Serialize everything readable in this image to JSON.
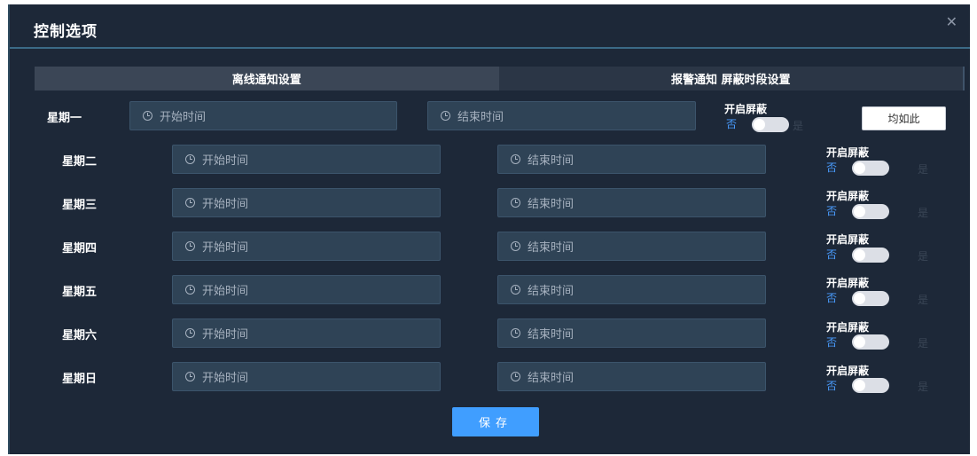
{
  "dialog": {
    "title": "控制选项",
    "close_icon": "close-icon"
  },
  "tabs": [
    {
      "label": "离线通知设置",
      "active": true
    },
    {
      "label": "报警通知 屏蔽时段设置",
      "active": false
    }
  ],
  "placeholders": {
    "start": "开始时间",
    "end": "结束时间"
  },
  "toggle": {
    "title": "开启屏蔽",
    "off": "否",
    "on": "是",
    "value": false
  },
  "days": [
    {
      "label": "星期一"
    },
    {
      "label": "星期二"
    },
    {
      "label": "星期三"
    },
    {
      "label": "星期四"
    },
    {
      "label": "星期五"
    },
    {
      "label": "星期六"
    },
    {
      "label": "星期日"
    }
  ],
  "actions": {
    "same_label": "均如此",
    "save_label": "保存"
  },
  "colors": {
    "background": "#1d2838",
    "field": "#2f4356",
    "accent": "#409eff",
    "off_text": "#4a9dff"
  }
}
